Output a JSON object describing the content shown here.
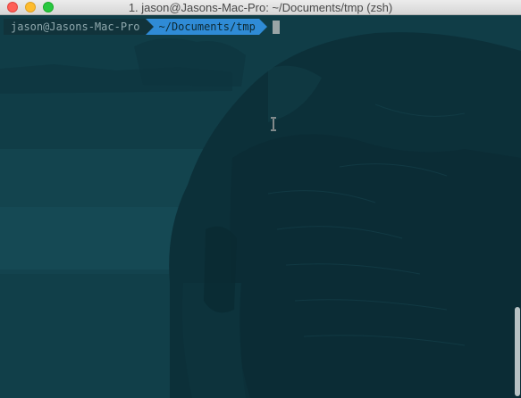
{
  "window": {
    "title": "1. jason@Jasons-Mac-Pro: ~/Documents/tmp (zsh)",
    "controls": [
      "close-icon",
      "minimize-icon",
      "zoom-icon"
    ]
  },
  "terminal": {
    "prompt": {
      "user_host": "jason@Jasons-Mac-Pro",
      "directory": "~/Documents/tmp"
    },
    "input": "",
    "background_image": "elephant",
    "colors": {
      "background": "#0f3a44",
      "user_segment": "#11333b",
      "user_text": "#8fa8ad",
      "dir_segment": "#2f8bd6",
      "dir_text": "#0d2a33",
      "cursor": "#9aa4a6"
    }
  }
}
